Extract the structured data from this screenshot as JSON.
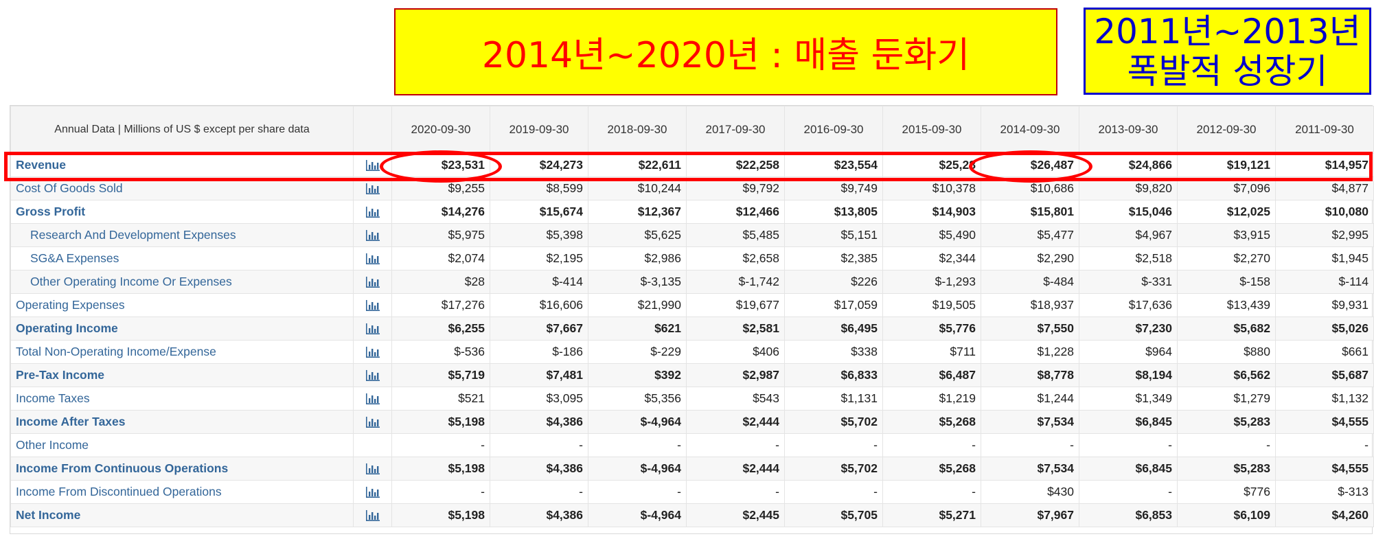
{
  "callouts": {
    "slowdown": "2014년~2020년 : 매출 둔화기",
    "growth_line1": "2011년~2013년",
    "growth_line2": "폭발적 성장기"
  },
  "colors": {
    "callout_bg": "#ffff00",
    "slowdown_text": "#ff0000",
    "growth_text": "#0000cc",
    "highlight": "#ff0000",
    "label_text": "#336699"
  },
  "table": {
    "header_label": "Annual Data | Millions of US $ except per share data",
    "columns": [
      "2020-09-30",
      "2019-09-30",
      "2018-09-30",
      "2017-09-30",
      "2016-09-30",
      "2015-09-30",
      "2014-09-30",
      "2013-09-30",
      "2012-09-30",
      "2011-09-30"
    ],
    "rows": [
      {
        "label": "Revenue",
        "bold": true,
        "indent": false,
        "icon": "bar-chart-icon",
        "values": [
          "$23,531",
          "$24,273",
          "$22,611",
          "$22,258",
          "$23,554",
          "$25,28",
          "$26,487",
          "$24,866",
          "$19,121",
          "$14,957"
        ]
      },
      {
        "label": "Cost Of Goods Sold",
        "bold": false,
        "indent": false,
        "icon": "bar-chart-icon",
        "values": [
          "$9,255",
          "$8,599",
          "$10,244",
          "$9,792",
          "$9,749",
          "$10,378",
          "$10,686",
          "$9,820",
          "$7,096",
          "$4,877"
        ]
      },
      {
        "label": "Gross Profit",
        "bold": true,
        "indent": false,
        "icon": "bar-chart-icon",
        "values": [
          "$14,276",
          "$15,674",
          "$12,367",
          "$12,466",
          "$13,805",
          "$14,903",
          "$15,801",
          "$15,046",
          "$12,025",
          "$10,080"
        ]
      },
      {
        "label": "Research And Development Expenses",
        "bold": false,
        "indent": true,
        "icon": "bar-chart-icon",
        "values": [
          "$5,975",
          "$5,398",
          "$5,625",
          "$5,485",
          "$5,151",
          "$5,490",
          "$5,477",
          "$4,967",
          "$3,915",
          "$2,995"
        ]
      },
      {
        "label": "SG&A Expenses",
        "bold": false,
        "indent": true,
        "icon": "bar-chart-icon",
        "values": [
          "$2,074",
          "$2,195",
          "$2,986",
          "$2,658",
          "$2,385",
          "$2,344",
          "$2,290",
          "$2,518",
          "$2,270",
          "$1,945"
        ]
      },
      {
        "label": "Other Operating Income Or Expenses",
        "bold": false,
        "indent": true,
        "icon": "bar-chart-icon",
        "values": [
          "$28",
          "$-414",
          "$-3,135",
          "$-1,742",
          "$226",
          "$-1,293",
          "$-484",
          "$-331",
          "$-158",
          "$-114"
        ]
      },
      {
        "label": "Operating Expenses",
        "bold": false,
        "indent": false,
        "icon": "bar-chart-icon",
        "values": [
          "$17,276",
          "$16,606",
          "$21,990",
          "$19,677",
          "$17,059",
          "$19,505",
          "$18,937",
          "$17,636",
          "$13,439",
          "$9,931"
        ]
      },
      {
        "label": "Operating Income",
        "bold": true,
        "indent": false,
        "icon": "bar-chart-icon",
        "values": [
          "$6,255",
          "$7,667",
          "$621",
          "$2,581",
          "$6,495",
          "$5,776",
          "$7,550",
          "$7,230",
          "$5,682",
          "$5,026"
        ]
      },
      {
        "label": "Total Non-Operating Income/Expense",
        "bold": false,
        "indent": false,
        "icon": "bar-chart-icon",
        "values": [
          "$-536",
          "$-186",
          "$-229",
          "$406",
          "$338",
          "$711",
          "$1,228",
          "$964",
          "$880",
          "$661"
        ]
      },
      {
        "label": "Pre-Tax Income",
        "bold": true,
        "indent": false,
        "icon": "bar-chart-icon",
        "values": [
          "$5,719",
          "$7,481",
          "$392",
          "$2,987",
          "$6,833",
          "$6,487",
          "$8,778",
          "$8,194",
          "$6,562",
          "$5,687"
        ]
      },
      {
        "label": "Income Taxes",
        "bold": false,
        "indent": false,
        "icon": "bar-chart-icon",
        "values": [
          "$521",
          "$3,095",
          "$5,356",
          "$543",
          "$1,131",
          "$1,219",
          "$1,244",
          "$1,349",
          "$1,279",
          "$1,132"
        ]
      },
      {
        "label": "Income After Taxes",
        "bold": true,
        "indent": false,
        "icon": "bar-chart-icon",
        "values": [
          "$5,198",
          "$4,386",
          "$-4,964",
          "$2,444",
          "$5,702",
          "$5,268",
          "$7,534",
          "$6,845",
          "$5,283",
          "$4,555"
        ]
      },
      {
        "label": "Other Income",
        "bold": false,
        "indent": false,
        "icon": "",
        "values": [
          "-",
          "-",
          "-",
          "-",
          "-",
          "-",
          "-",
          "-",
          "-",
          "-"
        ]
      },
      {
        "label": "Income From Continuous Operations",
        "bold": true,
        "indent": false,
        "icon": "bar-chart-icon",
        "values": [
          "$5,198",
          "$4,386",
          "$-4,964",
          "$2,444",
          "$5,702",
          "$5,268",
          "$7,534",
          "$6,845",
          "$5,283",
          "$4,555"
        ]
      },
      {
        "label": "Income From Discontinued Operations",
        "bold": false,
        "indent": false,
        "icon": "bar-chart-icon",
        "values": [
          "-",
          "-",
          "-",
          "-",
          "-",
          "-",
          "$430",
          "-",
          "$776",
          "$-313"
        ]
      },
      {
        "label": "Net Income",
        "bold": true,
        "indent": false,
        "icon": "bar-chart-icon",
        "values": [
          "$5,198",
          "$4,386",
          "$-4,964",
          "$2,445",
          "$5,705",
          "$5,271",
          "$7,967",
          "$6,853",
          "$6,109",
          "$4,260"
        ]
      }
    ]
  }
}
